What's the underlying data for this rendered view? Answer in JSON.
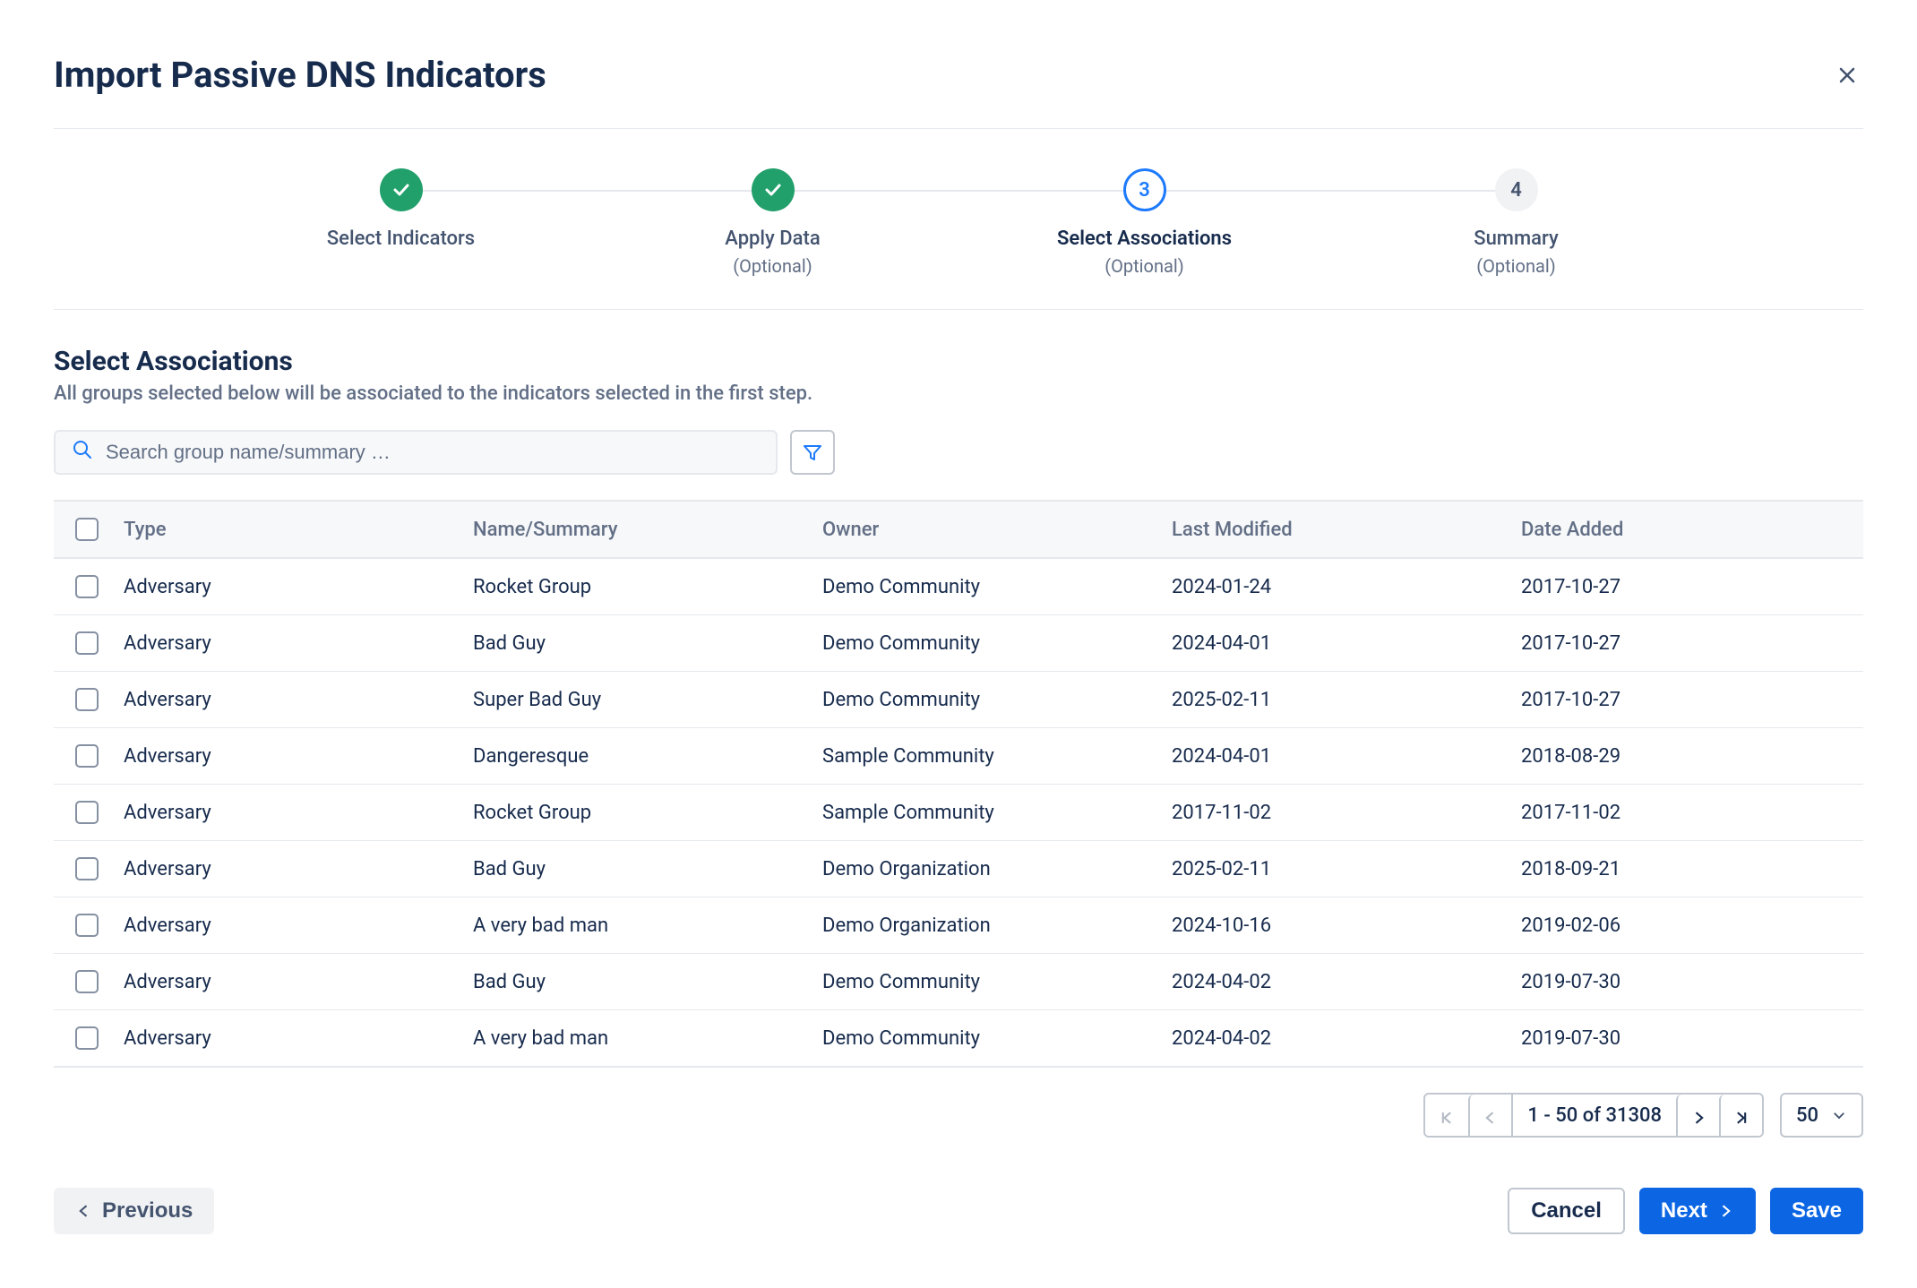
{
  "header": {
    "title": "Import Passive DNS Indicators"
  },
  "stepper": {
    "steps": [
      {
        "label": "Select Indicators",
        "state": "done",
        "optional": ""
      },
      {
        "label": "Apply Data",
        "state": "done",
        "optional": "(Optional)"
      },
      {
        "label": "Select Associations",
        "state": "active",
        "optional": "(Optional)",
        "number": "3"
      },
      {
        "label": "Summary",
        "state": "pending",
        "optional": "(Optional)",
        "number": "4"
      }
    ]
  },
  "section": {
    "title": "Select Associations",
    "description": "All groups selected below will be associated to the indicators selected in the first step."
  },
  "search": {
    "placeholder": "Search group name/summary …"
  },
  "table": {
    "columns": {
      "type": "Type",
      "name": "Name/Summary",
      "owner": "Owner",
      "modified": "Last Modified",
      "added": "Date Added"
    },
    "rows": [
      {
        "type": "Adversary",
        "name": "Rocket Group",
        "owner": "Demo Community",
        "modified": "2024-01-24",
        "added": "2017-10-27"
      },
      {
        "type": "Adversary",
        "name": "Bad Guy",
        "owner": "Demo Community",
        "modified": "2024-04-01",
        "added": "2017-10-27"
      },
      {
        "type": "Adversary",
        "name": "Super Bad Guy",
        "owner": "Demo Community",
        "modified": "2025-02-11",
        "added": "2017-10-27"
      },
      {
        "type": "Adversary",
        "name": "Dangeresque",
        "owner": "Sample Community",
        "modified": "2024-04-01",
        "added": "2018-08-29"
      },
      {
        "type": "Adversary",
        "name": "Rocket Group",
        "owner": "Sample Community",
        "modified": "2017-11-02",
        "added": "2017-11-02"
      },
      {
        "type": "Adversary",
        "name": "Bad Guy",
        "owner": "Demo Organization",
        "modified": "2025-02-11",
        "added": "2018-09-21"
      },
      {
        "type": "Adversary",
        "name": "A very bad man",
        "owner": "Demo Organization",
        "modified": "2024-10-16",
        "added": "2019-02-06"
      },
      {
        "type": "Adversary",
        "name": "Bad Guy",
        "owner": "Demo Community",
        "modified": "2024-04-02",
        "added": "2019-07-30"
      },
      {
        "type": "Adversary",
        "name": "A very bad man",
        "owner": "Demo Community",
        "modified": "2024-04-02",
        "added": "2019-07-30"
      }
    ]
  },
  "pagination": {
    "range": "1 - 50 of 31308",
    "page_size": "50"
  },
  "footer": {
    "previous": "Previous",
    "cancel": "Cancel",
    "next": "Next",
    "save": "Save"
  }
}
